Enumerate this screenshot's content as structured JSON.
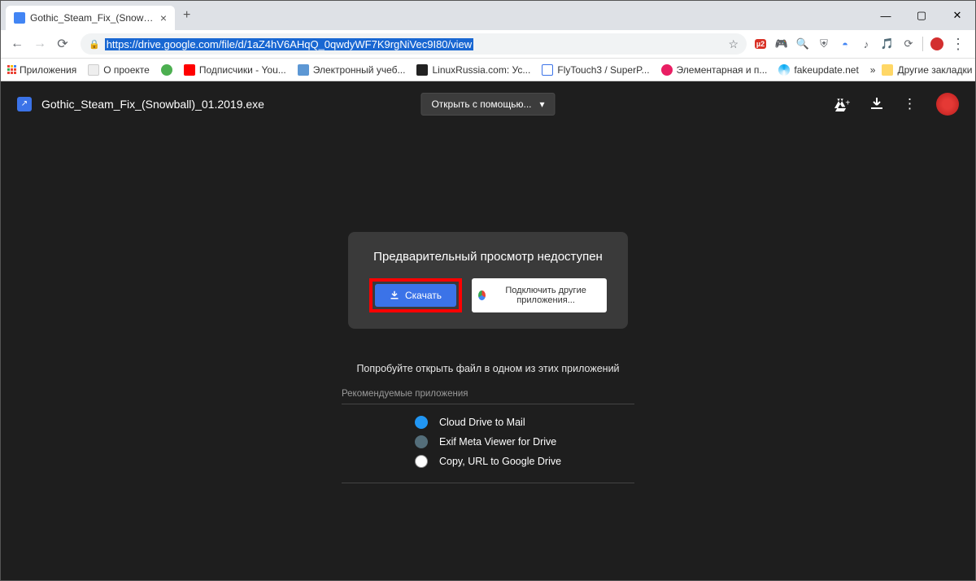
{
  "window": {
    "tab_title": "Gothic_Steam_Fix_(Snowball)_01..."
  },
  "url": "https://drive.google.com/file/d/1aZ4hV6AHqQ_0qwdyWF7K9rgNiVec9I80/view",
  "bookmarks": {
    "apps": "Приложения",
    "items": [
      {
        "label": "О проекте",
        "color": "#888"
      },
      {
        "label": "Подписчики - You...",
        "color": "#f00"
      },
      {
        "label": "Электронный учеб...",
        "color": "#5c97d4"
      },
      {
        "label": "LinuxRussia.com: Ус...",
        "color": "#222"
      },
      {
        "label": "FlyTouch3 / SuperP...",
        "color": "#3b73e8"
      },
      {
        "label": "Элементарная и п...",
        "color": "#e91e63"
      },
      {
        "label": "fakeupdate.net",
        "color": "#03a9f4"
      }
    ],
    "other": "Другие закладки"
  },
  "drive": {
    "filename": "Gothic_Steam_Fix_(Snowball)_01.2019.exe",
    "open_with": "Открыть с помощью...",
    "preview_unavailable": "Предварительный просмотр недоступен",
    "download": "Скачать",
    "connect_apps": "Подключить другие приложения...",
    "try_open": "Попробуйте открыть файл в одном из этих приложений",
    "recommended": "Рекомендуемые приложения",
    "apps": [
      {
        "label": "Cloud Drive to Mail",
        "color": "#2196f3"
      },
      {
        "label": "Exif Meta Viewer for Drive",
        "color": "#546e7a"
      },
      {
        "label": "Copy, URL to Google Drive",
        "color": "#fff"
      }
    ]
  }
}
